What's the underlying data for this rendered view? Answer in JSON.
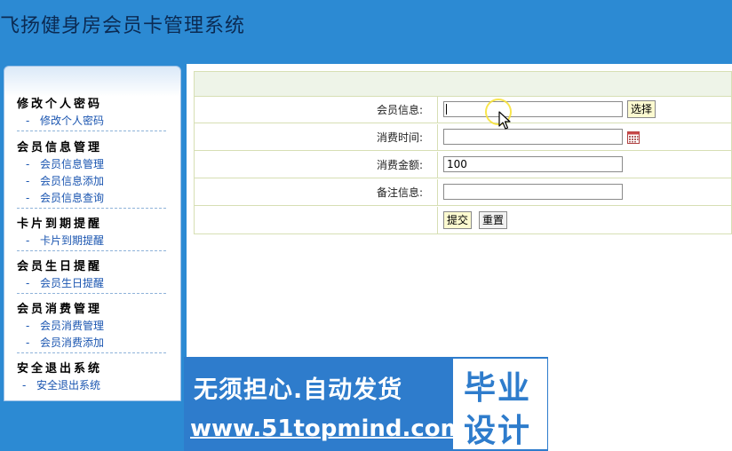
{
  "header": {
    "title": "飞扬健身房会员卡管理系统"
  },
  "sidebar": {
    "groups": [
      {
        "title": "修改个人密码",
        "items": [
          "修改个人密码"
        ]
      },
      {
        "title": "会员信息管理",
        "items": [
          "会员信息管理",
          "会员信息添加",
          "会员信息查询"
        ]
      },
      {
        "title": "卡片到期提醒",
        "items": [
          "卡片到期提醒"
        ]
      },
      {
        "title": "会员生日提醒",
        "items": [
          "会员生日提醒"
        ]
      },
      {
        "title": "会员消费管理",
        "items": [
          "会员消费管理",
          "会员消费添加"
        ]
      },
      {
        "title": "安全退出系统",
        "items": [
          "安全退出系统"
        ]
      }
    ],
    "item_prefix": "-"
  },
  "form": {
    "member_info": {
      "label": "会员信息:",
      "value": "",
      "select_button": "选择"
    },
    "consume_time": {
      "label": "消费时间:",
      "value": ""
    },
    "consume_amount": {
      "label": "消费金额:",
      "value": "100"
    },
    "remark": {
      "label": "备注信息:",
      "value": ""
    },
    "submit_button": "提交",
    "reset_button": "重置"
  },
  "banner": {
    "line1": "无须担心.自动发货",
    "line2": "www.51topmind.com",
    "badge_line1": "毕业",
    "badge_line2": "设计"
  },
  "colors": {
    "header_bg": "#2c8ad3",
    "banner_bg": "#2e7ccc",
    "button_bg": "#fcfad0"
  }
}
